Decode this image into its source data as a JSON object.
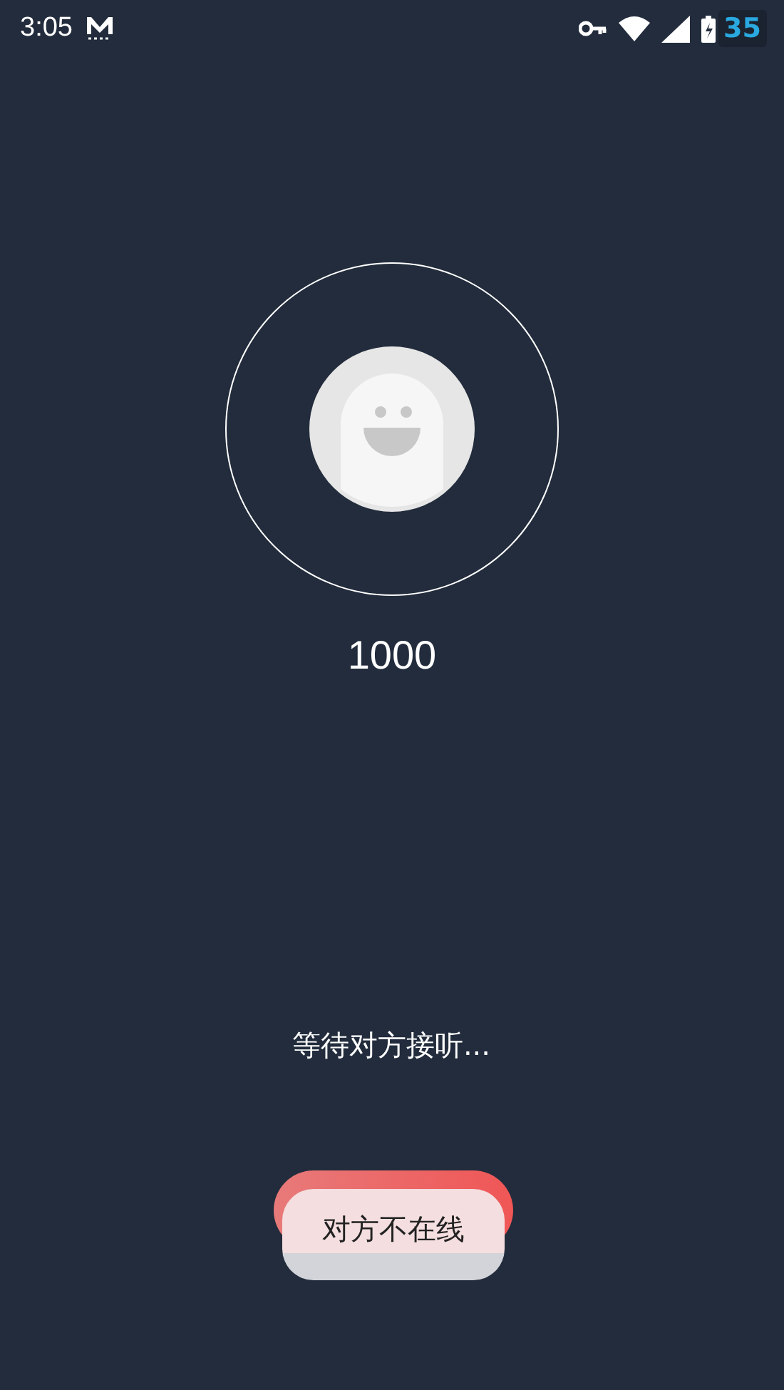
{
  "status_bar": {
    "time": "3:05",
    "battery_badge": "35"
  },
  "call": {
    "number": "1000",
    "status": "等待对方接听..."
  },
  "toast": {
    "text": "对方不在线"
  }
}
